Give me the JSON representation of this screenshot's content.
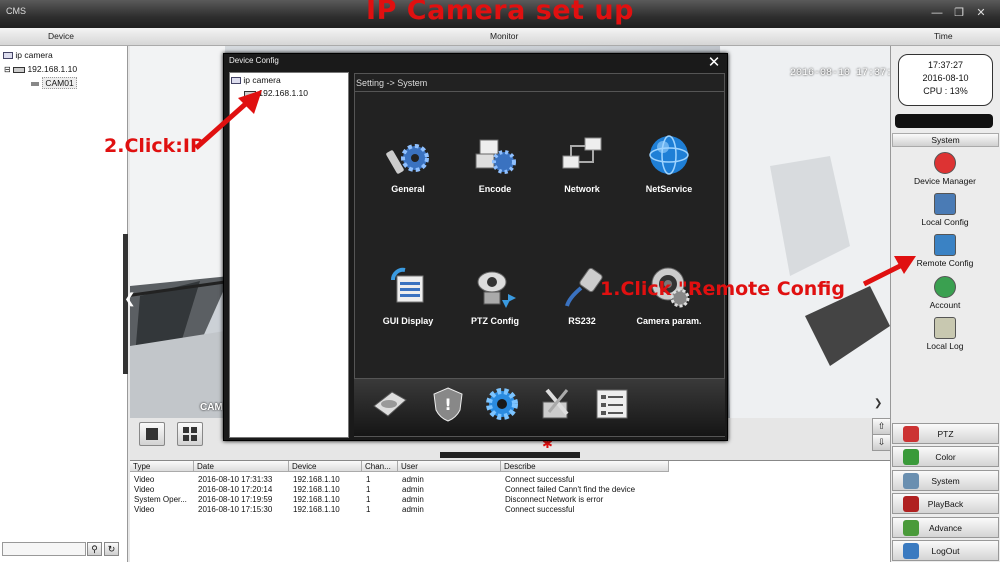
{
  "window": {
    "app_title": "CMS",
    "overlay_title": "IP Camera set up"
  },
  "headers": {
    "device": "Device",
    "monitor": "Monitor",
    "time": "Time"
  },
  "device_tree": {
    "root": "ip camera",
    "ip": "192.168.1.10",
    "channel": "CAM01"
  },
  "camera": {
    "timestamp": "2016-08-10 17:37:26",
    "label": "CAM"
  },
  "clock": {
    "time": "17:37:27",
    "date": "2016-08-10",
    "cpu": "CPU : 13%"
  },
  "right_panel": {
    "system_header": "System",
    "items": [
      {
        "label": "Device Manager",
        "icon": "device-manager-icon"
      },
      {
        "label": "Local Config",
        "icon": "local-config-icon"
      },
      {
        "label": "Remote Config",
        "icon": "remote-config-icon"
      },
      {
        "label": "Account",
        "icon": "account-icon"
      },
      {
        "label": "Local Log",
        "icon": "local-log-icon"
      }
    ],
    "nav": [
      {
        "label": "PTZ",
        "icon": "ptz-icon"
      },
      {
        "label": "Color",
        "icon": "color-icon"
      },
      {
        "label": "System",
        "icon": "system-icon"
      },
      {
        "label": "PlayBack",
        "icon": "playback-icon"
      },
      {
        "label": "Advance",
        "icon": "advance-icon"
      },
      {
        "label": "LogOut",
        "icon": "logout-icon"
      }
    ]
  },
  "dialog": {
    "title": "Device Config",
    "close": "✕",
    "tree_root": "ip camera",
    "tree_ip": "192.168.1.10",
    "breadcrumb": "Setting -> System",
    "items": [
      {
        "label": "General",
        "icon": "general-icon"
      },
      {
        "label": "Encode",
        "icon": "encode-icon"
      },
      {
        "label": "Network",
        "icon": "network-icon"
      },
      {
        "label": "NetService",
        "icon": "netservice-icon"
      },
      {
        "label": "GUI Display",
        "icon": "gui-display-icon"
      },
      {
        "label": "PTZ Config",
        "icon": "ptz-config-icon"
      },
      {
        "label": "RS232",
        "icon": "rs232-icon"
      },
      {
        "label": "Camera param.",
        "icon": "camera-param-icon"
      }
    ]
  },
  "annotations": {
    "step1": "1.Click \"Remote Config",
    "step2": "2.Click:IP"
  },
  "log": {
    "columns": [
      "Type",
      "Date",
      "Device",
      "Chan...",
      "User",
      "Describe"
    ],
    "rows": [
      [
        "Video",
        "2016-08-10 17:31:33",
        "192.168.1.10",
        "1",
        "admin",
        "Connect successful"
      ],
      [
        "Video",
        "2016-08-10 17:20:14",
        "192.168.1.10",
        "1",
        "admin",
        "Connect failed Cann't find the device"
      ],
      [
        "System Oper...",
        "2016-08-10 17:19:59",
        "192.168.1.10",
        "1",
        "admin",
        "Disconnect Network is error"
      ],
      [
        "Video",
        "2016-08-10 17:15:30",
        "192.168.1.10",
        "1",
        "admin",
        "Connect successful"
      ]
    ]
  },
  "colors": {
    "annotation_red": "#e01010",
    "dialog_bg": "#1a1a1a",
    "accent_blue": "#2a8be0"
  }
}
